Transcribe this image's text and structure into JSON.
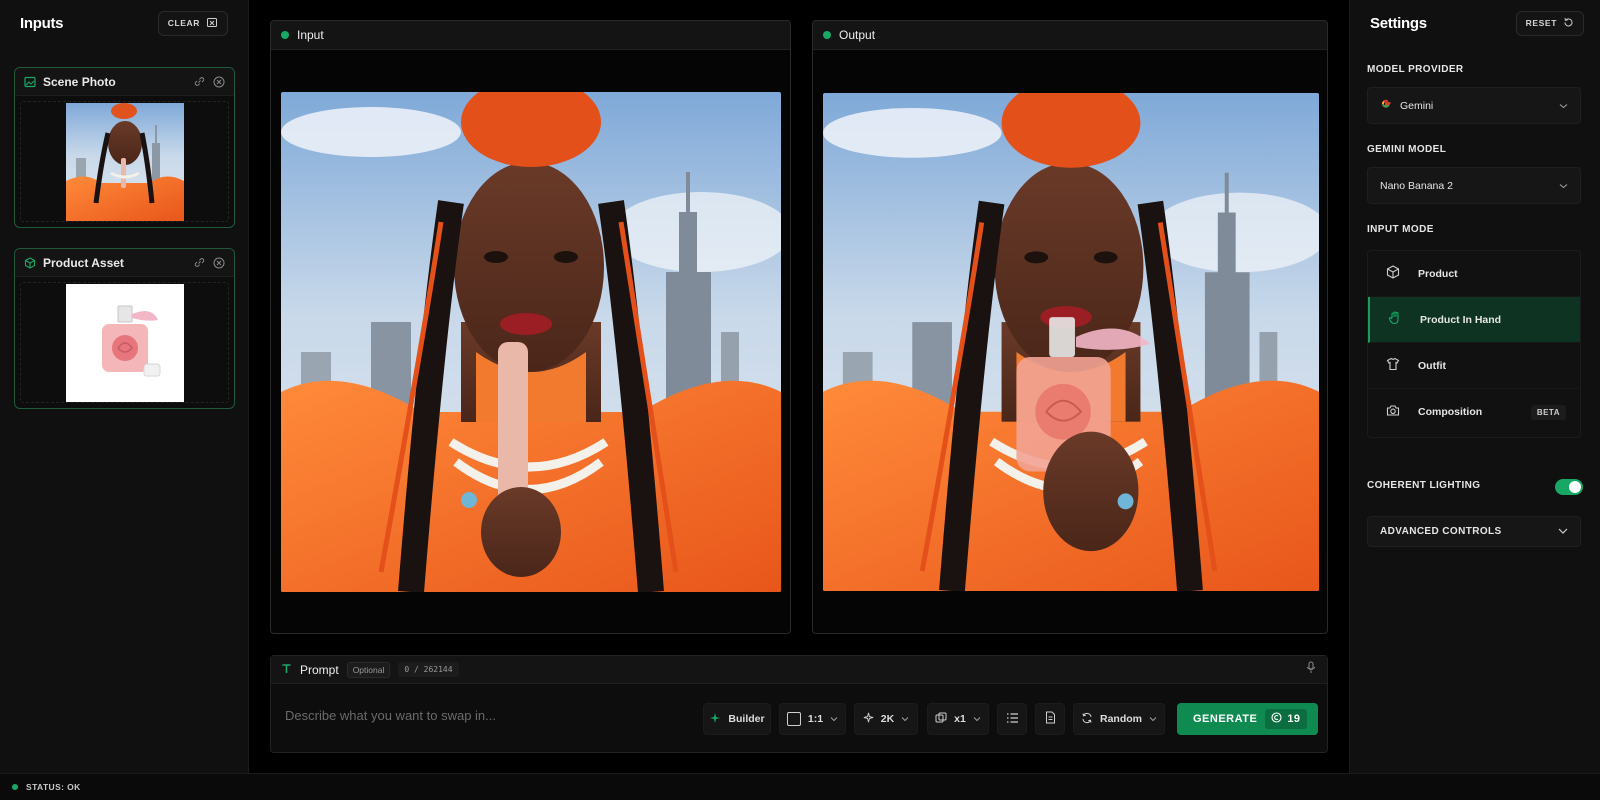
{
  "inputs_panel": {
    "title": "Inputs",
    "clear_label": "CLEAR",
    "cards": [
      {
        "label": "Scene Photo"
      },
      {
        "label": "Product Asset"
      }
    ]
  },
  "input_panel": {
    "label": "Input"
  },
  "output_panel": {
    "label": "Output"
  },
  "prompt": {
    "title": "Prompt",
    "optional_tag": "Optional",
    "char_counter": "0 / 262144",
    "placeholder": "Describe what you want to swap in..."
  },
  "toolbar": {
    "builder_label": "Builder",
    "aspect_ratio": "1:1",
    "resolution": "2K",
    "count": "x1",
    "seed_mode": "Random",
    "generate_label": "GENERATE",
    "credits": "19"
  },
  "settings": {
    "title": "Settings",
    "reset_label": "RESET",
    "model_provider_label": "MODEL PROVIDER",
    "model_provider_value": "Gemini",
    "gemini_model_label": "GEMINI MODEL",
    "gemini_model_value": "Nano Banana 2",
    "input_mode_label": "INPUT MODE",
    "modes": [
      {
        "label": "Product",
        "icon": "cube-icon"
      },
      {
        "label": "Product In Hand",
        "icon": "hand-icon"
      },
      {
        "label": "Outfit",
        "icon": "shirt-icon"
      },
      {
        "label": "Composition",
        "icon": "camera-icon",
        "badge": "BETA"
      }
    ],
    "active_mode": "Product In Hand",
    "coherent_lighting_label": "COHERENT LIGHTING",
    "coherent_lighting_on": true,
    "advanced_controls_label": "ADVANCED CONTROLS"
  },
  "status": {
    "text": "STATUS: OK"
  },
  "colors": {
    "accent": "#17a865",
    "generate": "#0f8b52",
    "active_mode_bg": "#0e3322"
  }
}
